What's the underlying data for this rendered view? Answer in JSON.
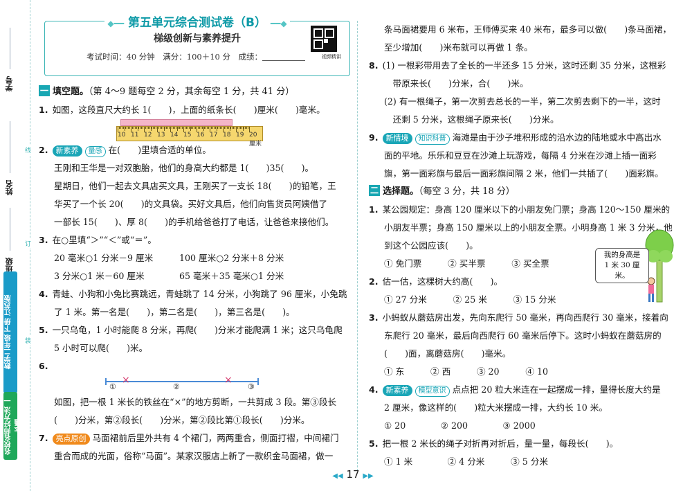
{
  "sidebar": {
    "label_xuehao": "学号",
    "label_xingming": "姓名",
    "label_banji": "班级",
    "brand_text": "名校名师好方法 一本通",
    "brand_edition": "数学二年级 下册 江苏版",
    "xian": "线",
    "ding": "订",
    "zhuang": "装"
  },
  "header": {
    "title": "第五单元综合测试卷（B）",
    "subtitle": "梯级创新与素养提升",
    "info": "考试时间：40 分钟　满分：100＋10 分　成绩：",
    "qr_label": "视频精讲"
  },
  "section1": {
    "num": "一",
    "title": "填空题。",
    "note": "（第 4～9 题每空 2 分，其余每空 1 分，共 41 分）"
  },
  "left_lines": [
    {
      "q": "1.",
      "text": "如图，这段直尺大约长 1(　　)，上面的纸条长(　　)厘米(　　)毫米。"
    },
    {
      "q": "2.",
      "tag": "新素养",
      "tag2": "量感",
      "text": "在(　　)里填合适的单位。"
    },
    {
      "text": "王刚和王华是一对双胞胎，他们的身高大约都是 1(　　)35(　　)。",
      "indent": true
    },
    {
      "text": "星期日，他们一起去文具店买文具，王刚买了一支长 18(　　)的铅笔，王",
      "indent": true
    },
    {
      "text": "华买了一个长 20(　　)的文具袋。买好文具后，他们向售货员阿姨借了",
      "indent": true
    },
    {
      "text": "一部长 15(　　)、厚 8(　　)的手机给爸爸打了电话，让爸爸来接他们。",
      "indent": true
    },
    {
      "q": "3.",
      "text": "在○里填“＞”“＜”或“＝”。"
    },
    {
      "text": "20 毫米○1 分米－9 厘米　　　100 厘米○2 分米＋8 分米",
      "indent": true
    },
    {
      "text": "3 分米○1 米－60 厘米　　　　65 毫米＋35 毫米○1 分米",
      "indent": true
    },
    {
      "q": "4.",
      "text": "青蛙、小狗和小兔比赛跳远，青蛙跳了 14 分米，小狗跳了 96 厘米，小兔跳"
    },
    {
      "text": "了 1 米。第一名是(　　)，第二名是(　　)，第三名是(　　)。",
      "indent": true
    },
    {
      "q": "5.",
      "text": "一只乌龟，1 小时能爬 8 分米，再爬(　　)分米才能爬满 1 米；这只乌龟爬"
    },
    {
      "text": "5 小时可以爬(　　)米。",
      "indent": true
    },
    {
      "q": "6.",
      "text": ""
    },
    {
      "text": "如图，把一根 1 米长的铁丝在“×”的地方剪断，一共剪成 3 段。第③段长",
      "indent": true
    },
    {
      "text": "(　　)分米，第②段长(　　)分米，第②段比第①段长(　　)分米。",
      "indent": true
    },
    {
      "q": "7.",
      "tag": "亮点原创",
      "tag_color": "orange",
      "text": "马面裙前后里外共有 4 个裙门，两两重合，侧面打褶，中间裙门"
    },
    {
      "text": "重合而成的光面，俗称“马面”。某家汉服店上新了一款织金马面裙，做一",
      "indent": true
    }
  ],
  "ruler": {
    "numbers": [
      "10",
      "11",
      "12",
      "13",
      "14",
      "15",
      "16",
      "17",
      "18",
      "19",
      "20厘米"
    ]
  },
  "wire": {
    "marks": [
      "①",
      "②",
      "③"
    ],
    "cut": "×"
  },
  "right_lines": [
    {
      "text": "条马面裙要用 6 米布，王师傅买来 40 米布，最多可以做(　　)条马面裙，",
      "indent": true
    },
    {
      "text": "至少增加(　　)米布就可以再做 1 条。",
      "indent": true
    },
    {
      "q": "8.",
      "text": "(1) 一根彩带用去了全长的一半还多 15 分米，这时还剩 35 分米，这根彩"
    },
    {
      "text": "　带原来长(　　)分米，合(　　)米。",
      "indent": true
    },
    {
      "text": "(2) 有一根绳子，第一次剪去总长的一半，第二次剪去剩下的一半，这时",
      "indent": true
    },
    {
      "text": "　还剩 5 分米，这根绳子原来长(　　)分米。",
      "indent": true
    },
    {
      "q": "9.",
      "tag": "新情境",
      "tag2": "知识科普",
      "text": "海滩是由于沙子堆积形成的沿水边的陆地或水中高出水"
    },
    {
      "text": "面的平地。乐乐和豆豆在沙滩上玩游戏，每隔 4 分米在沙滩上插一面彩",
      "indent": true
    },
    {
      "text": "旗，第一面彩旗与最后一面彩旗间隔 2 米，他们一共插了(　　)面彩旗。",
      "indent": true
    }
  ],
  "section2": {
    "num": "二",
    "title": "选择题。",
    "note": "（每空 3 分，共 18 分）"
  },
  "right_lines2": [
    {
      "q": "1.",
      "text": "某公园规定：身高 120 厘米以下的小朋友免门票；身高 120～150 厘米的"
    },
    {
      "text": "小朋友半票；身高 150 厘米以上的小朋友全票。小明身高 1 米 3 分米，他",
      "indent": true
    },
    {
      "text": "到这个公园应该(　　)。",
      "indent": true
    },
    {
      "text": "① 免门票　　　② 买半票　　　③ 买全票",
      "indent": true
    },
    {
      "q": "2.",
      "text": "估一估，这棵树大约高(　　)。"
    },
    {
      "text": "① 27 分米　　　② 25 米　　　③ 15 分米",
      "indent": true
    },
    {
      "q": "3.",
      "text": "小蚂蚁从蘑菇房出发，先向东爬行 50 毫米，再向西爬行 30 毫米，接着向"
    },
    {
      "text": "东爬行 20 毫米，最后向西爬行 60 毫米后停下。这时小蚂蚁在蘑菇房的",
      "indent": true
    },
    {
      "text": "(　　)面，离蘑菇房(　　)毫米。",
      "indent": true
    },
    {
      "text": "① 东　　　② 西　　　③ 20　　　④ 10",
      "indent": true
    },
    {
      "q": "4.",
      "tag": "新素养",
      "tag2": "模型意识",
      "text": "点点把 20 粒大米连在一起摆成一排，量得长度大约是"
    },
    {
      "text": "2 厘米，像这样的(　　)粒大米摆成一排，大约长 10 米。",
      "indent": true
    },
    {
      "text": "① 20　　　　② 200　　　　③ 2000",
      "indent": true
    },
    {
      "q": "5.",
      "text": "把一根 2 米长的绳子对折再对折后，量一量，每段长(　　)。"
    },
    {
      "text": "① 1 米　　　　② 4 分米　　　③ 5 分米",
      "indent": true
    }
  ],
  "bubble": {
    "line1": "我的身高是",
    "line2": "1 米 30 厘米。"
  },
  "footer": {
    "page": "17"
  }
}
